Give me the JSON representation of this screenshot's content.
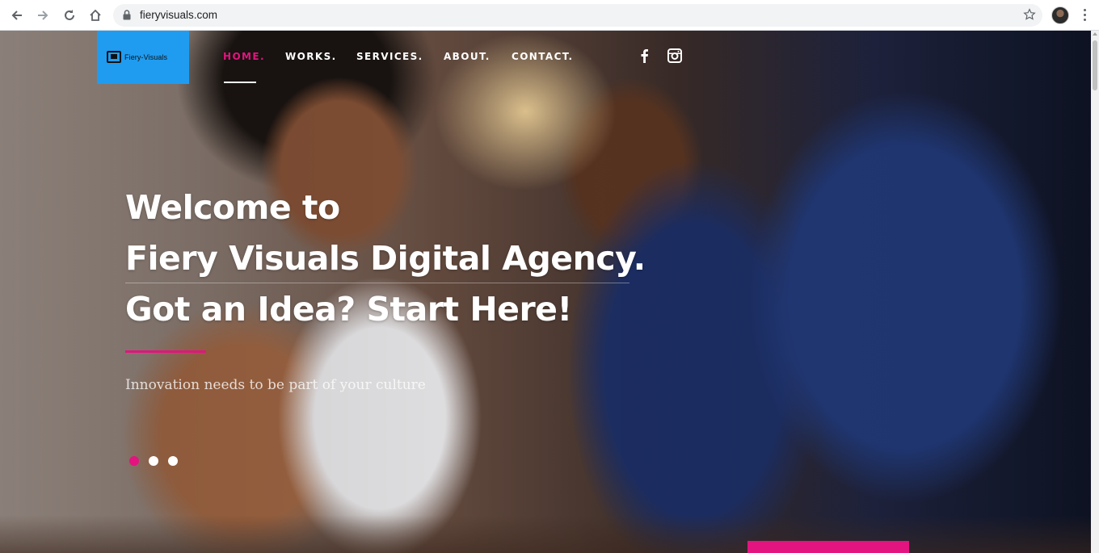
{
  "browser": {
    "url": "fieryvisuals.com",
    "icons": [
      "back-arrow-icon",
      "forward-arrow-icon",
      "reload-icon",
      "home-icon",
      "lock-icon",
      "star-icon",
      "profile-avatar",
      "kebab-menu-icon"
    ]
  },
  "site": {
    "logo_text": "Fiery-Visuals",
    "nav": [
      {
        "label": "HOME.",
        "active": true
      },
      {
        "label": "WORKS.",
        "active": false
      },
      {
        "label": "SERVICES.",
        "active": false
      },
      {
        "label": "ABOUT.",
        "active": false
      },
      {
        "label": "CONTACT.",
        "active": false
      }
    ],
    "social": [
      "facebook-icon",
      "instagram-icon"
    ]
  },
  "hero": {
    "headline": [
      "Welcome to",
      "Fiery Visuals Digital Agency.",
      "Got an Idea? Start Here!"
    ],
    "tagline": "Innovation needs to be part of your culture",
    "slides": 3,
    "active_slide": 1
  },
  "colors": {
    "accent": "#e3147f",
    "logo_bg": "#1f9cf0",
    "text": "#ffffff"
  }
}
